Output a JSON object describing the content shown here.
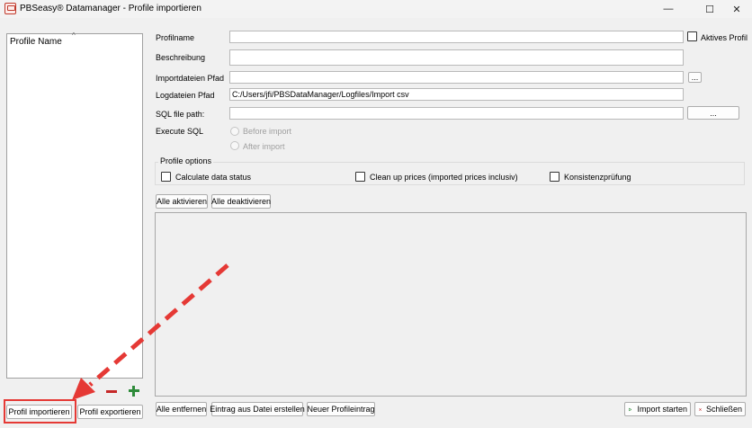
{
  "window": {
    "title": "PBSeasy® Datamanager - Profile importieren",
    "minimize_glyph": "—",
    "maximize_glyph": "☐",
    "close_glyph": "✕"
  },
  "profile_list": {
    "column_header": "Profile Name",
    "sort_glyph": "^"
  },
  "form": {
    "profilname": {
      "label": "Profilname",
      "value": ""
    },
    "aktives_profil_label": "Aktives Profil",
    "beschreibung": {
      "label": "Beschreibung",
      "value": ""
    },
    "importdateien": {
      "label": "Importdateien Pfad",
      "value": "",
      "browse_label": "..."
    },
    "logdateien": {
      "label": "Logdateien Pfad",
      "value": "C:/Users/jfi/PBSDataManager/Logfiles/Import csv"
    },
    "sql_file": {
      "label": "SQL file path:",
      "value": "",
      "browse_label": "..."
    },
    "execute_sql": {
      "label": "Execute SQL",
      "options": [
        "Before import",
        "After import"
      ]
    }
  },
  "profile_options": {
    "title": "Profile options",
    "calculate_data_status": "Calculate data status",
    "clean_up_prices": "Clean up prices (imported prices inclusiv)",
    "konsistenzpruefung": "Konsistenzprüfung"
  },
  "buttons": {
    "alle_aktivieren": "Alle aktivieren",
    "alle_deaktivieren": "Alle deaktivieren",
    "alle_entfernen": "Alle entfernen",
    "eintrag_aus_datei": "Eintrag aus Datei erstellen",
    "neuer_profileintrag": "Neuer Profileintrag",
    "import_starten": "Import starten",
    "schliessen": "Schließen",
    "profil_importieren": "Profil importieren",
    "profil_exportieren": "Profil exportieren"
  },
  "icons": {
    "play": "play-icon",
    "close": "close-x-icon",
    "minus": "remove-icon",
    "plus": "add-icon"
  },
  "colors": {
    "highlight": "#e53935",
    "remove": "#c62828",
    "add": "#2e8b3a"
  }
}
